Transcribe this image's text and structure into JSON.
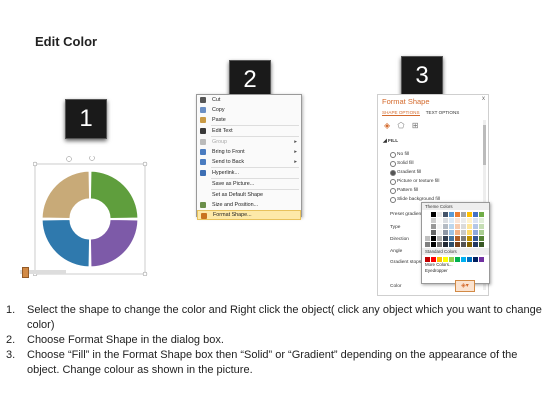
{
  "title": "Edit Color",
  "steps": [
    "1",
    "2",
    "3"
  ],
  "ring": {
    "segments": [
      {
        "name": "top-left",
        "color": "#c8aa78"
      },
      {
        "name": "top-right",
        "color": "#5f9e3d"
      },
      {
        "name": "bottom-left",
        "color": "#2f79ad"
      },
      {
        "name": "bottom-right",
        "color": "#7d5aa8"
      }
    ]
  },
  "context_menu": {
    "items": [
      {
        "label": "Cut",
        "icon": "scissors-icon",
        "color": "#555555"
      },
      {
        "label": "Copy",
        "icon": "copy-icon",
        "color": "#6a8fc5"
      },
      {
        "label": "Paste",
        "icon": "paste-icon",
        "color": "#c99a45"
      },
      {
        "sep": true
      },
      {
        "label": "Edit Text",
        "icon": "edit-text-icon",
        "color": "#3a3a3a"
      },
      {
        "sep": true
      },
      {
        "label": "Group",
        "icon": "group-icon",
        "color": "#bbbbbb",
        "disabled": true,
        "submenu": true
      },
      {
        "label": "Bring to Front",
        "icon": "bring-front-icon",
        "color": "#4a7cc0",
        "submenu": true
      },
      {
        "label": "Send to Back",
        "icon": "send-back-icon",
        "color": "#4a7cc0",
        "submenu": true
      },
      {
        "sep": true
      },
      {
        "label": "Hyperlink...",
        "icon": "hyperlink-icon",
        "color": "#3d6fb4"
      },
      {
        "sep": true
      },
      {
        "label": "Save as Picture...",
        "icon": "",
        "color": ""
      },
      {
        "sep": true
      },
      {
        "label": "Set as Default Shape",
        "icon": "",
        "color": ""
      },
      {
        "label": "Size and Position...",
        "icon": "size-position-icon",
        "color": "#6b8f4a"
      },
      {
        "label": "Format Shape...",
        "icon": "format-shape-icon",
        "color": "#c9731f",
        "highlight": true
      }
    ]
  },
  "format_pane": {
    "title": "Format Shape",
    "close": "x",
    "tabs": [
      "SHAPE OPTIONS",
      "TEXT OPTIONS"
    ],
    "section": "FILL",
    "fill_options": [
      {
        "label": "No fill",
        "selected": false
      },
      {
        "label": "Solid fill",
        "selected": false
      },
      {
        "label": "Gradient fill",
        "selected": true
      },
      {
        "label": "Picture or texture fill",
        "selected": false
      },
      {
        "label": "Pattern fill",
        "selected": false
      },
      {
        "label": "Slide background fill",
        "selected": false
      }
    ],
    "rows": [
      "Preset gradients",
      "Type",
      "Direction",
      "Angle",
      "Gradient stops",
      "Color"
    ]
  },
  "palette": {
    "theme_header": "Theme Colors",
    "standard_header": "Standard Colors",
    "more_colors": "More Colors...",
    "eyedropper": "Eyedropper",
    "theme_top": [
      "#ffffff",
      "#000000",
      "#e7e6e6",
      "#44546a",
      "#5b9bd5",
      "#ed7d31",
      "#a5a5a5",
      "#ffc000",
      "#4472c4",
      "#70ad47"
    ],
    "standard": [
      "#c00000",
      "#ff0000",
      "#ffc000",
      "#ffff00",
      "#92d050",
      "#00b050",
      "#00b0f0",
      "#0070c0",
      "#002060",
      "#7030a0"
    ]
  },
  "instructions": [
    {
      "num": "1.",
      "text": "Select the shape to change the color and Right click the object( click any object which you want to change color)"
    },
    {
      "num": "2.",
      "text": "Choose Format Shape in the dialog box."
    },
    {
      "num": "3.",
      "text": "Choose “Fill” in the Format Shape box then “Solid” or “Gradient” depending on the appearance of the object. Change colour as shown in the picture."
    }
  ]
}
